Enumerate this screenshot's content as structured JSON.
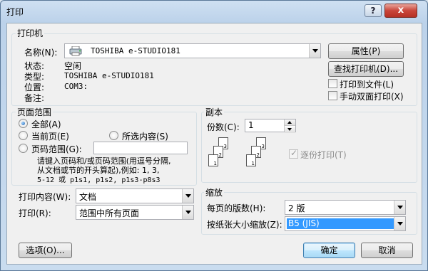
{
  "title": "打印",
  "titlebar": {
    "help_label": "?",
    "close_label": "x"
  },
  "printer": {
    "group_title": "打印机",
    "name_label": "名称(N):",
    "name_value": "TOSHIBA e-STUDIO181",
    "status_label": "状态:",
    "status_value": "空闲",
    "type_label": "类型:",
    "type_value": "TOSHIBA e-STUDIO181",
    "location_label": "位置:",
    "location_value": "COM3:",
    "comment_label": "备注:",
    "properties_button": "属性(P)",
    "find_button": "查找打印机(D)...",
    "print_to_file": "打印到文件(L)",
    "manual_duplex": "手动双面打印(X)"
  },
  "page_range": {
    "group_title": "页面范围",
    "all": "全部(A)",
    "current": "当前页(E)",
    "selection": "所选内容(S)",
    "pages": "页码范围(G):",
    "pages_value": "",
    "hint_line1": "请键入页码和/或页码范围(用逗号分隔,",
    "hint_line2": "从文档或节的开头算起),例如: 1, 3,",
    "hint_line3": "5-12 或 p1s1, p1s2, p1s3-p8s3"
  },
  "copies": {
    "group_title": "副本",
    "count_label": "份数(C):",
    "count_value": "1",
    "collate_label": "逐份打印(T)",
    "page_nums": [
      "3",
      "2",
      "1"
    ]
  },
  "print_what": {
    "label": "打印内容(W):",
    "value": "文档"
  },
  "print_scope": {
    "label": "打印(R):",
    "value": "范围中所有页面"
  },
  "zoom": {
    "group_title": "缩放",
    "pages_per_sheet_label": "每页的版数(H):",
    "pages_per_sheet_value": "2 版",
    "scale_label": "按纸张大小缩放(Z):",
    "scale_value": "B5 (JIS)"
  },
  "footer": {
    "options_button": "选项(O)...",
    "ok_button": "确定",
    "cancel_button": "取消"
  }
}
